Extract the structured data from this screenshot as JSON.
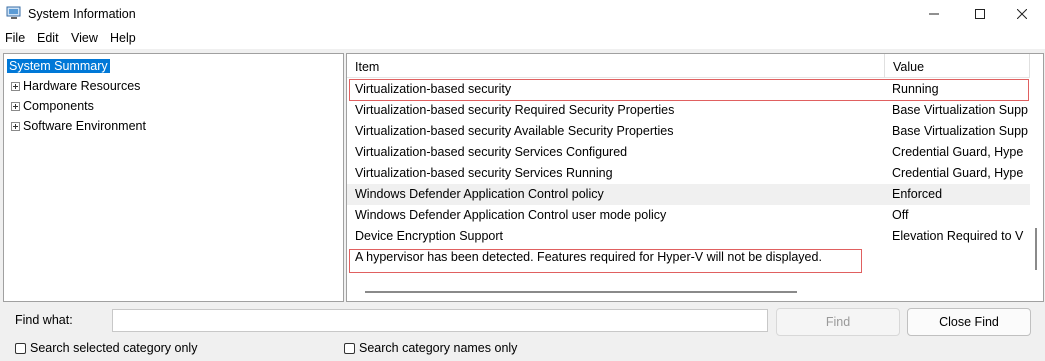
{
  "window": {
    "title": "System Information",
    "minimize_icon": "minimize-icon",
    "maximize_icon": "maximize-icon",
    "close_icon": "close-icon"
  },
  "menu": [
    "File",
    "Edit",
    "View",
    "Help"
  ],
  "tree": {
    "selected": "System Summary",
    "items": [
      "Hardware Resources",
      "Components",
      "Software Environment"
    ]
  },
  "table": {
    "headers": [
      "Item",
      "Value"
    ],
    "rows": [
      {
        "item": "Virtualization-based security",
        "value": "Running"
      },
      {
        "item": "Virtualization-based security Required Security Properties",
        "value": "Base Virtualization Supp"
      },
      {
        "item": "Virtualization-based security Available Security Properties",
        "value": "Base Virtualization Supp"
      },
      {
        "item": "Virtualization-based security Services Configured",
        "value": "Credential Guard, Hype"
      },
      {
        "item": "Virtualization-based security Services Running",
        "value": "Credential Guard, Hype"
      },
      {
        "item": "Windows Defender Application Control policy",
        "value": "Enforced"
      },
      {
        "item": "Windows Defender Application Control user mode policy",
        "value": "Off"
      },
      {
        "item": "Device Encryption Support",
        "value": "Elevation Required to V"
      },
      {
        "item": "A hypervisor has been detected. Features required for Hyper-V will not be displayed.",
        "value": ""
      }
    ]
  },
  "find": {
    "label": "Find what:",
    "value": "",
    "find_button": "Find",
    "close_button": "Close Find",
    "search_selected": "Search selected category only",
    "search_names": "Search category names only"
  },
  "colors": {
    "selection": "#0078d7",
    "highlight_box": "#e06060"
  }
}
